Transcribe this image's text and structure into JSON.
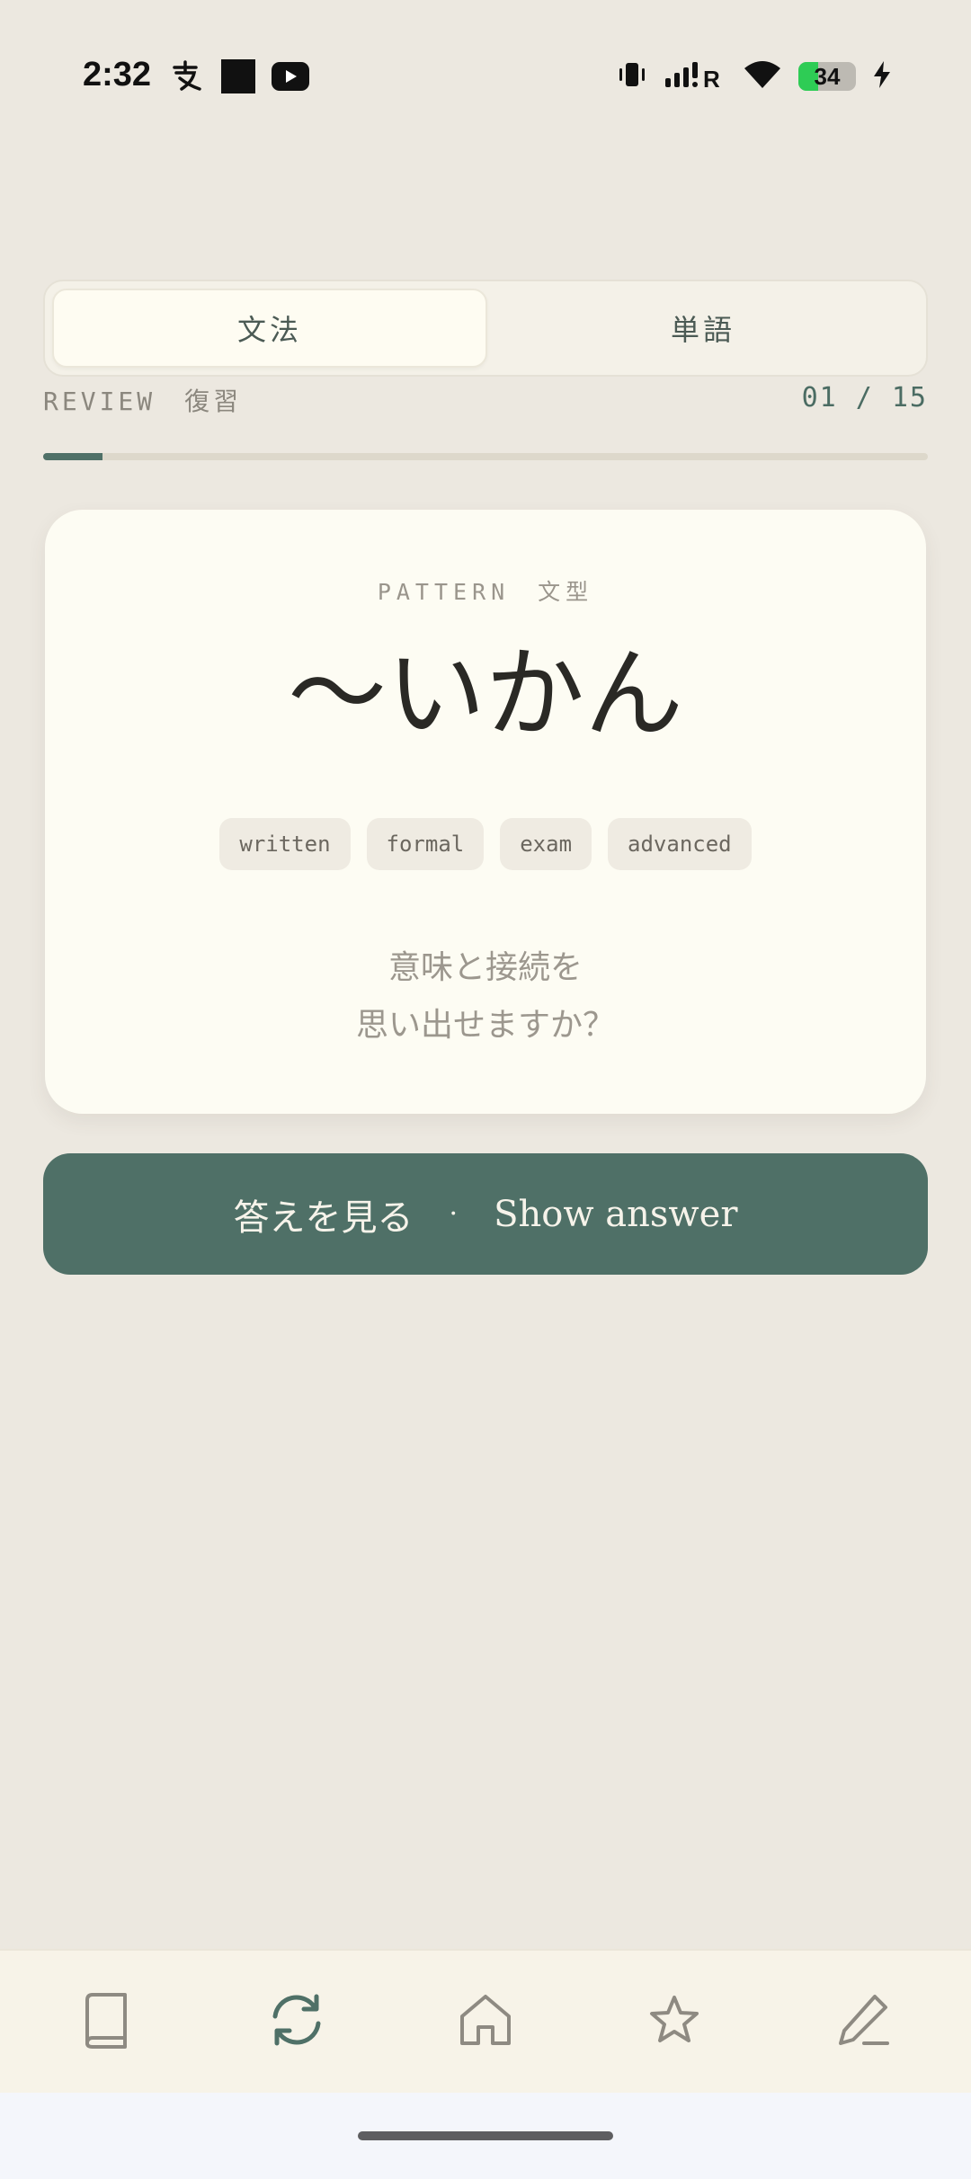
{
  "status_bar": {
    "time": "2:32",
    "battery_percent": 34,
    "battery_label": "34",
    "left_icons": [
      "alipay-icon",
      "square-notification-icon",
      "youtube-icon"
    ],
    "right_icons": [
      "vibrate-icon",
      "signal-icon",
      "wifi-icon",
      "battery-icon",
      "charging-icon"
    ]
  },
  "tabs": [
    {
      "label": "文法",
      "active": true
    },
    {
      "label": "単語",
      "active": false
    }
  ],
  "review": {
    "label": "REVIEW　復習",
    "count": "01 / 15",
    "progress": 0.0667
  },
  "card": {
    "label": "PATTERN　文型",
    "pattern": "〜いかん",
    "tags": [
      "written",
      "formal",
      "exam",
      "advanced"
    ],
    "prompt_line1": "意味と接続を",
    "prompt_line2": "思い出せますか？"
  },
  "answer_button": {
    "jp_label": "答えを見る",
    "separator": "·",
    "en_label": "Show answer"
  },
  "bottom_nav": {
    "items": [
      {
        "icon": "book-icon",
        "active": false
      },
      {
        "icon": "refresh-icon",
        "active": true
      },
      {
        "icon": "home-icon",
        "active": false
      },
      {
        "icon": "star-icon",
        "active": false
      },
      {
        "icon": "pencil-icon",
        "active": false
      }
    ]
  },
  "colors": {
    "background": "#ece8e0",
    "accent": "#4f7067",
    "card": "#fdfcf3",
    "icon_inactive": "#8e8a82"
  }
}
